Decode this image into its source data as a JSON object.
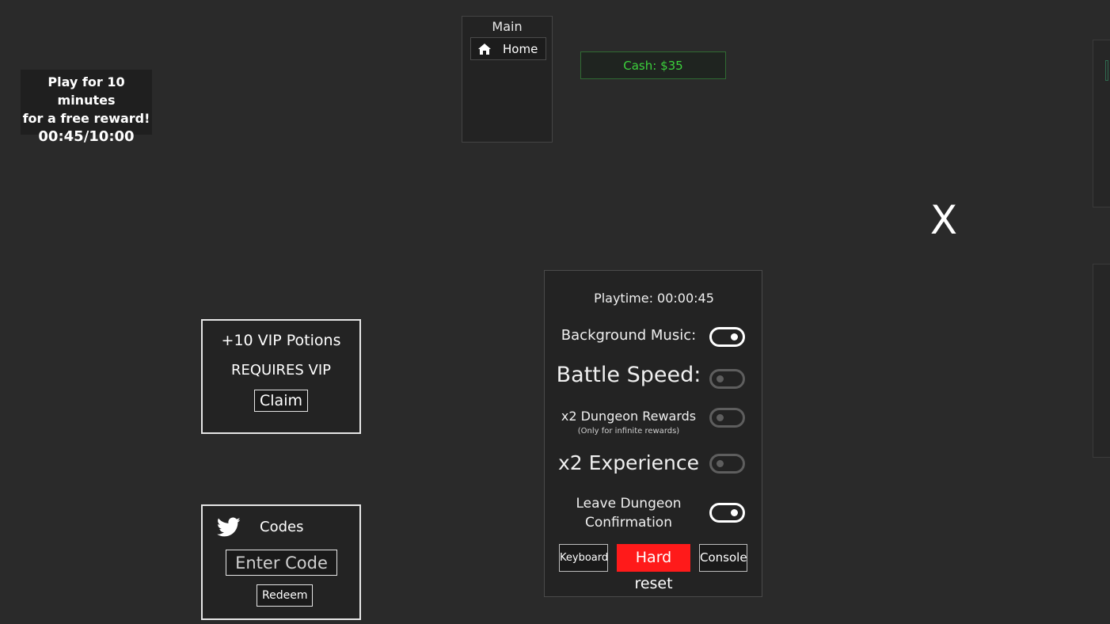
{
  "reward": {
    "line1": "Play for 10 minutes",
    "line2": "for a free reward!",
    "timer": "00:45/10:00"
  },
  "main_menu": {
    "title": "Main",
    "home_label": "Home",
    "home_icon": "home-icon"
  },
  "cash": {
    "label": "Cash: $35"
  },
  "close": {
    "label": "X"
  },
  "vip": {
    "title": "+10 VIP Potions",
    "requirement": "REQUIRES VIP",
    "claim_label": "Claim"
  },
  "codes": {
    "title": "Codes",
    "icon": "twitter-bird-icon",
    "input_placeholder": "Enter Code",
    "redeem_label": "Redeem"
  },
  "settings": {
    "playtime": "Playtime: 00:00:45",
    "background_music": {
      "label": "Background Music:",
      "enabled": true
    },
    "battle_speed": {
      "label": "Battle Speed:",
      "enabled": false
    },
    "dungeon_rewards": {
      "label": "x2 Dungeon Rewards",
      "note": "(Only for infinite rewards)",
      "enabled": false
    },
    "experience": {
      "label": "x2 Experience",
      "enabled": false
    },
    "leave_confirm": {
      "label_line1": "Leave Dungeon",
      "label_line2": "Confirmation",
      "enabled": true
    },
    "keyboard_label": "Keyboard",
    "hard_reset_label": "Hard reset",
    "console_label": "Console"
  },
  "colors": {
    "background": "#2a2a2a",
    "cash_green": "#3cd13c",
    "hard_reset_red": "#ff1a1a",
    "toggle_on": "#ffffff",
    "toggle_off": "#5e5e5e"
  }
}
